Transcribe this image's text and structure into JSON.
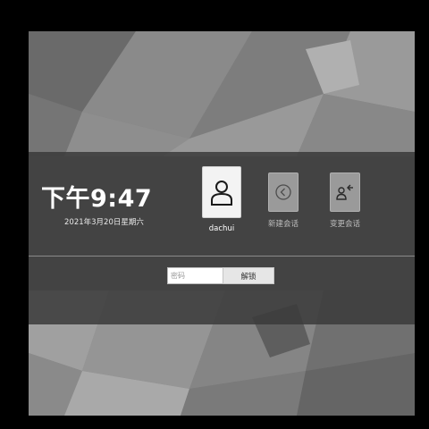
{
  "lock_screen": {
    "clock": {
      "time": "下午9:47",
      "date": "2021年3月20日星期六"
    },
    "sessions": [
      {
        "label": "dachui",
        "icon": "user-icon"
      },
      {
        "label": "新建会话",
        "icon": "arrow-left-circle-icon"
      },
      {
        "label": "变更会话",
        "icon": "switch-user-icon"
      }
    ],
    "password": {
      "placeholder": "密码",
      "value": ""
    },
    "unlock_label": "解锁"
  },
  "colors": {
    "panel": "#3a3a3a",
    "tile_active": "#f3f3f3",
    "tile_inactive": "#9a9a9a",
    "button": "#e6e6e6"
  }
}
